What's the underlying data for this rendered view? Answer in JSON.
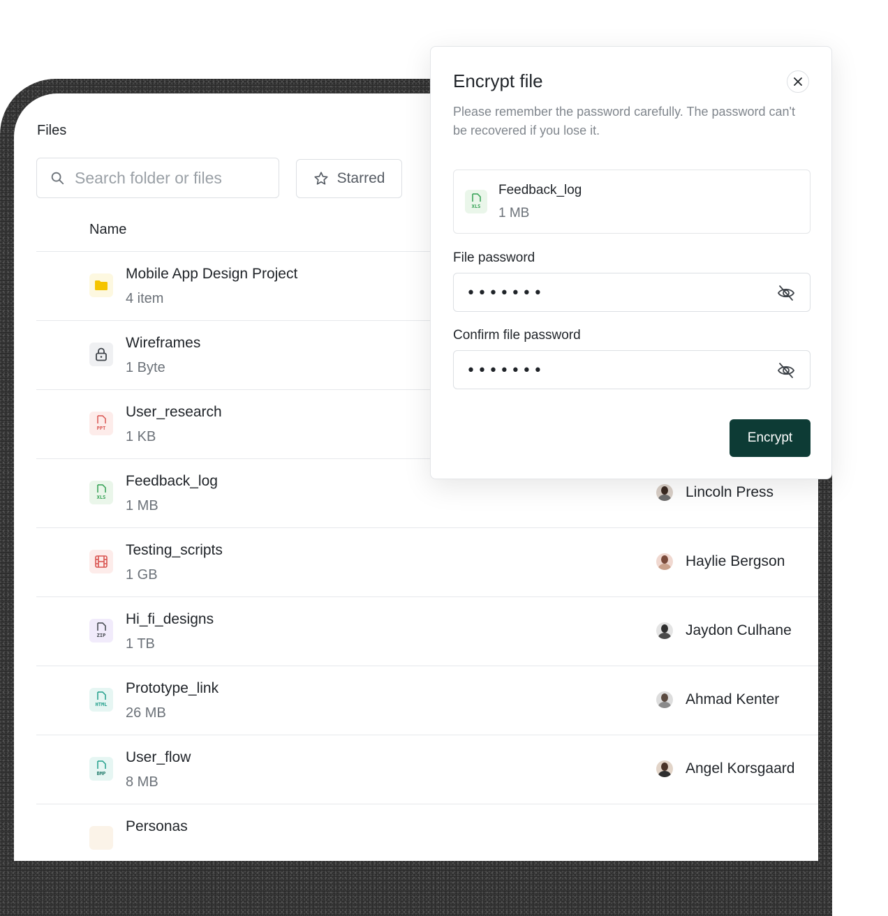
{
  "files_panel": {
    "title": "Files",
    "search": {
      "placeholder": "Search folder or files"
    },
    "starred_label": "Starred",
    "columns": {
      "name": "Name"
    },
    "rows": [
      {
        "name": "Mobile App Design Project",
        "size": "4 item",
        "icon": "folder-icon",
        "owner": ""
      },
      {
        "name": "Wireframes",
        "size": "1 Byte",
        "icon": "lock-icon",
        "owner": ""
      },
      {
        "name": "User_research",
        "size": "1 KB",
        "icon": "ppt-file-icon",
        "tag": "PPT",
        "owner": ""
      },
      {
        "name": "Feedback_log",
        "size": "1 MB",
        "icon": "xls-file-icon",
        "tag": "XLS",
        "owner": "Lincoln Press"
      },
      {
        "name": "Testing_scripts",
        "size": "1 GB",
        "icon": "film-icon",
        "owner": "Haylie Bergson"
      },
      {
        "name": "Hi_fi_designs",
        "size": "1 TB",
        "icon": "zip-file-icon",
        "tag": "ZIP",
        "owner": "Jaydon Culhane"
      },
      {
        "name": "Prototype_link",
        "size": "26 MB",
        "icon": "html-file-icon",
        "tag": "HTML",
        "owner": "Ahmad Kenter"
      },
      {
        "name": "User_flow",
        "size": "8 MB",
        "icon": "bmp-file-icon",
        "tag": "BMP",
        "owner": "Angel Korsgaard"
      },
      {
        "name": "Personas",
        "size": "",
        "icon": "file-icon",
        "owner": ""
      }
    ]
  },
  "modal": {
    "title": "Encrypt file",
    "description": "Please remember the password carefully. The password can't be recovered if you lose it.",
    "file": {
      "name": "Feedback_log",
      "size": "1 MB",
      "tag": "XLS"
    },
    "password_label": "File password",
    "password_value": "•••••••",
    "confirm_label": "Confirm file password",
    "confirm_value": "•••••••",
    "submit_label": "Encrypt"
  },
  "colors": {
    "primary_button": "#0d3b35",
    "folder": "#f5c400",
    "ppt": "#d9534f",
    "xls": "#2e9e4f",
    "zip": "#7b4fd6",
    "html": "#1f9e8a",
    "bmp": "#1f9e8a"
  }
}
